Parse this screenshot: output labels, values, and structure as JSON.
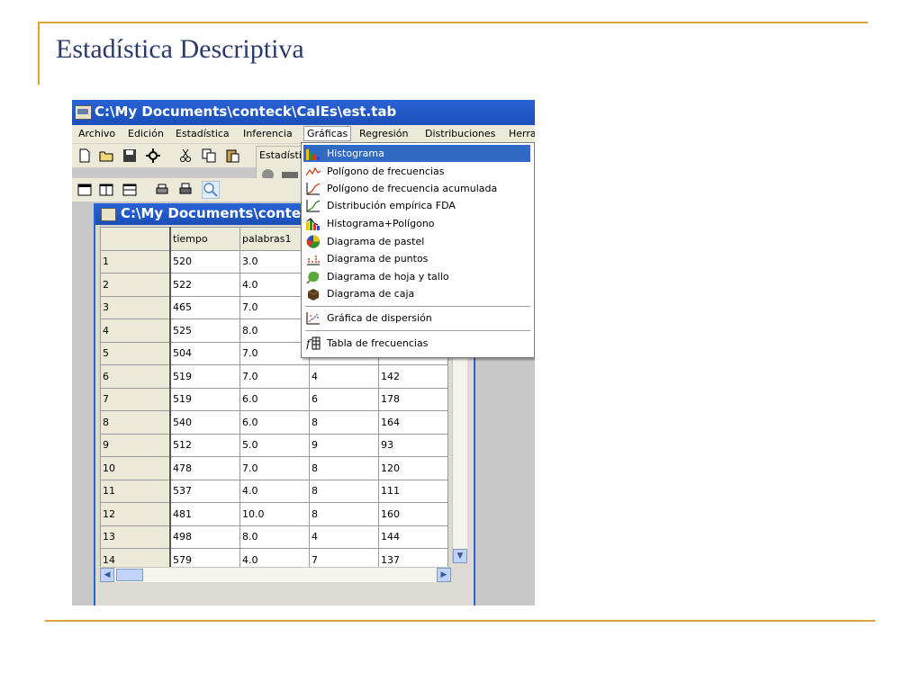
{
  "slide": {
    "title": "Estadística Descriptiva"
  },
  "app": {
    "window_title": "C:\\My Documents\\conteck\\CalEs\\est.tab",
    "menu": [
      "Archivo",
      "Edición",
      "Estadística",
      "Inferencia",
      "Gráficas",
      "Regresión",
      "Distribuciones",
      "Herra"
    ],
    "subpanel_label": "Estadísti"
  },
  "doc": {
    "window_title": "C:\\My Documents\\conteck\\C",
    "columns": [
      "",
      "tiempo",
      "palabras1",
      "",
      ""
    ],
    "rows": [
      [
        "1",
        "520",
        "3.0",
        "",
        ""
      ],
      [
        "2",
        "522",
        "4.0",
        "",
        ""
      ],
      [
        "3",
        "465",
        "7.0",
        "",
        ""
      ],
      [
        "4",
        "525",
        "8.0",
        "",
        ""
      ],
      [
        "5",
        "504",
        "7.0",
        "",
        ""
      ],
      [
        "6",
        "519",
        "7.0",
        "4",
        "142"
      ],
      [
        "7",
        "519",
        "6.0",
        "6",
        "178"
      ],
      [
        "8",
        "540",
        "6.0",
        "8",
        "164"
      ],
      [
        "9",
        "512",
        "5.0",
        "9",
        "93"
      ],
      [
        "10",
        "478",
        "7.0",
        "8",
        "120"
      ],
      [
        "11",
        "537",
        "4.0",
        "8",
        "111"
      ],
      [
        "12",
        "481",
        "10.0",
        "8",
        "160"
      ],
      [
        "13",
        "498",
        "8.0",
        "4",
        "144"
      ],
      [
        "14",
        "579",
        "4.0",
        "7",
        "137"
      ]
    ]
  },
  "dropdown": {
    "items": [
      {
        "label": "Histograma",
        "icon": "histogram-icon"
      },
      {
        "label": "Polígono de frecuencias",
        "icon": "polygon-icon"
      },
      {
        "label": "Polígono de frecuencia acumulada",
        "icon": "cumulative-polygon-icon"
      },
      {
        "label": "Distribución empírica FDA",
        "icon": "ecdf-icon"
      },
      {
        "label": "Histograma+Polígono",
        "icon": "histogram-polygon-icon"
      },
      {
        "label": "Diagrama de pastel",
        "icon": "pie-chart-icon"
      },
      {
        "label": "Diagrama de puntos",
        "icon": "dot-plot-icon"
      },
      {
        "label": "Diagrama de hoja y tallo",
        "icon": "stem-leaf-icon"
      },
      {
        "label": "Diagrama de caja",
        "icon": "box-plot-icon"
      },
      {
        "label": "Gráfica de dispersión",
        "icon": "scatter-icon"
      },
      {
        "label": "Tabla de frecuencias",
        "icon": "frequency-table-icon"
      }
    ]
  },
  "colors": {
    "accent_rule": "#d9a53a",
    "title_text": "#2b3a6b",
    "titlebar_blue": "#2a62d6",
    "menu_highlight": "#316ac5"
  }
}
